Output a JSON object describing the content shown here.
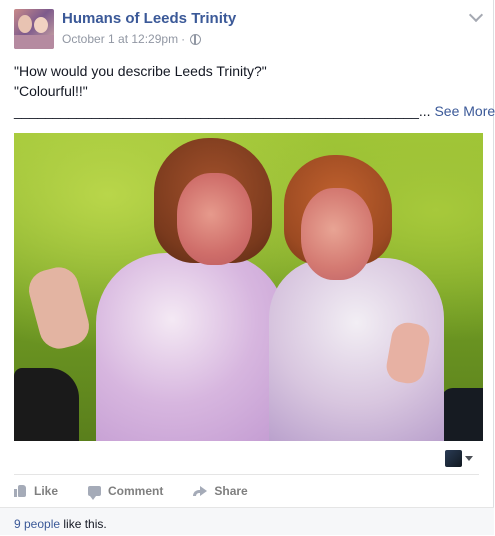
{
  "post": {
    "page_name": "Humans of Leeds Trinity",
    "timestamp": "October 1 at 12:29pm",
    "separator": "·",
    "privacy_icon": "globe-icon",
    "options_icon": "chevron-down-icon",
    "text_line1": "\"How would you describe Leeds Trinity?\"",
    "text_line2": "\"Colourful!!\"",
    "text_line3_rule": "____________________________________________________",
    "see_more_prefix": "... ",
    "see_more": "See More"
  },
  "actions": {
    "like": "Like",
    "comment": "Comment",
    "share": "Share"
  },
  "likes": {
    "count_link": "9 people",
    "suffix": " like this."
  },
  "colors": {
    "link": "#3b5998",
    "meta": "#9197a3",
    "action_text": "#7f7f7f"
  }
}
